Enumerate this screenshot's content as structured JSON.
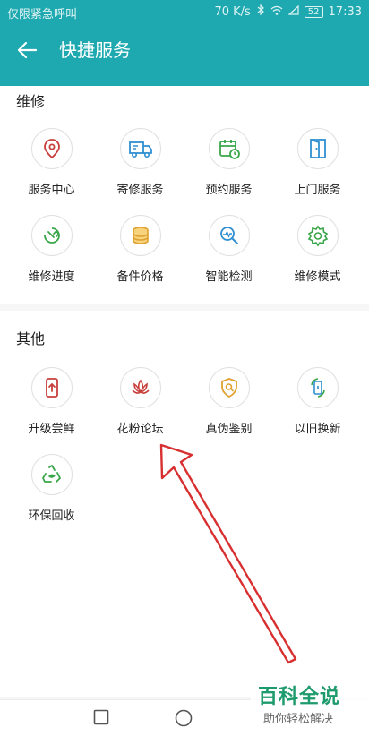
{
  "status_bar": {
    "carrier": "仅限紧急呼叫",
    "speed": "70 K/s",
    "battery": "52",
    "time": "17:33"
  },
  "app_bar": {
    "title": "快捷服务"
  },
  "sections": [
    {
      "title": "维修",
      "items": [
        {
          "label": "服务中心",
          "icon": "location-pin-icon"
        },
        {
          "label": "寄修服务",
          "icon": "delivery-truck-icon"
        },
        {
          "label": "预约服务",
          "icon": "calendar-clock-icon"
        },
        {
          "label": "上门服务",
          "icon": "door-icon"
        },
        {
          "label": "维修进度",
          "icon": "wrench-progress-icon"
        },
        {
          "label": "备件价格",
          "icon": "coins-icon"
        },
        {
          "label": "智能检测",
          "icon": "magnifier-pulse-icon"
        },
        {
          "label": "维修模式",
          "icon": "gear-mode-icon"
        }
      ]
    },
    {
      "title": "其他",
      "items": [
        {
          "label": "升级尝鲜",
          "icon": "phone-upgrade-icon"
        },
        {
          "label": "花粉论坛",
          "icon": "lotus-icon"
        },
        {
          "label": "真伪鉴别",
          "icon": "shield-search-icon"
        },
        {
          "label": "以旧换新",
          "icon": "phone-exchange-icon"
        },
        {
          "label": "环保回收",
          "icon": "recycle-icon"
        }
      ]
    }
  ],
  "watermark": {
    "title": "百科全说",
    "subtitle": "助你轻松解决"
  },
  "colors": {
    "header": "#1ea9b0",
    "icon_red": "#c8403c",
    "icon_blue": "#2f8fd0",
    "icon_green": "#3aa64a",
    "icon_orange": "#e0a030",
    "annotation_arrow": "#d83030"
  }
}
